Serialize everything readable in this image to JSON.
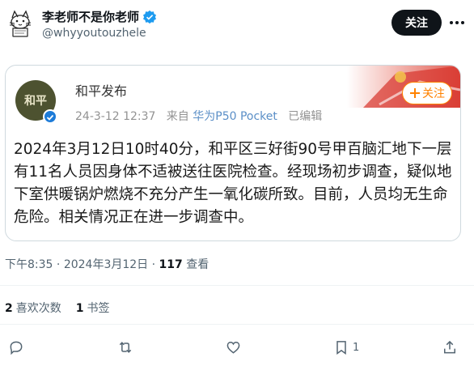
{
  "author": {
    "display_name": "李老师不是你老师",
    "handle": "@whyyoutouzhele",
    "follow_label": "关注"
  },
  "embedded_post": {
    "name": "和平发布",
    "avatar_text": "和平",
    "date": "24-3-12 12:37",
    "source_prefix": "来自",
    "source_device": "华为P50 Pocket",
    "edited": "已编辑",
    "follow_label": "关注",
    "text": "2024年3月12日10时40分，和平区三好街90号甲百脑汇地下一层有11名人员因身体不适被送往医院检查。经现场初步调查，疑似地下室供暖锅炉燃烧不充分产生一氧化碳所致。目前，人员均无生命危险。相关情况正在进一步调查中。"
  },
  "post_meta": {
    "time": "下午8:35",
    "sep": " · ",
    "date": "2024年3月12日",
    "sep2": " · ",
    "views_count": "117",
    "views_label": " 查看"
  },
  "stats": {
    "quotes_count": "2",
    "quotes_label": "喜欢次数",
    "bookmarks_count": "1",
    "bookmarks_label": "书签"
  },
  "actions": {
    "bookmark_count": "1"
  },
  "colors": {
    "accent": "#1d9bf0",
    "weibo_orange": "#ff8200",
    "text_primary": "#0f1419",
    "text_secondary": "#536471"
  }
}
